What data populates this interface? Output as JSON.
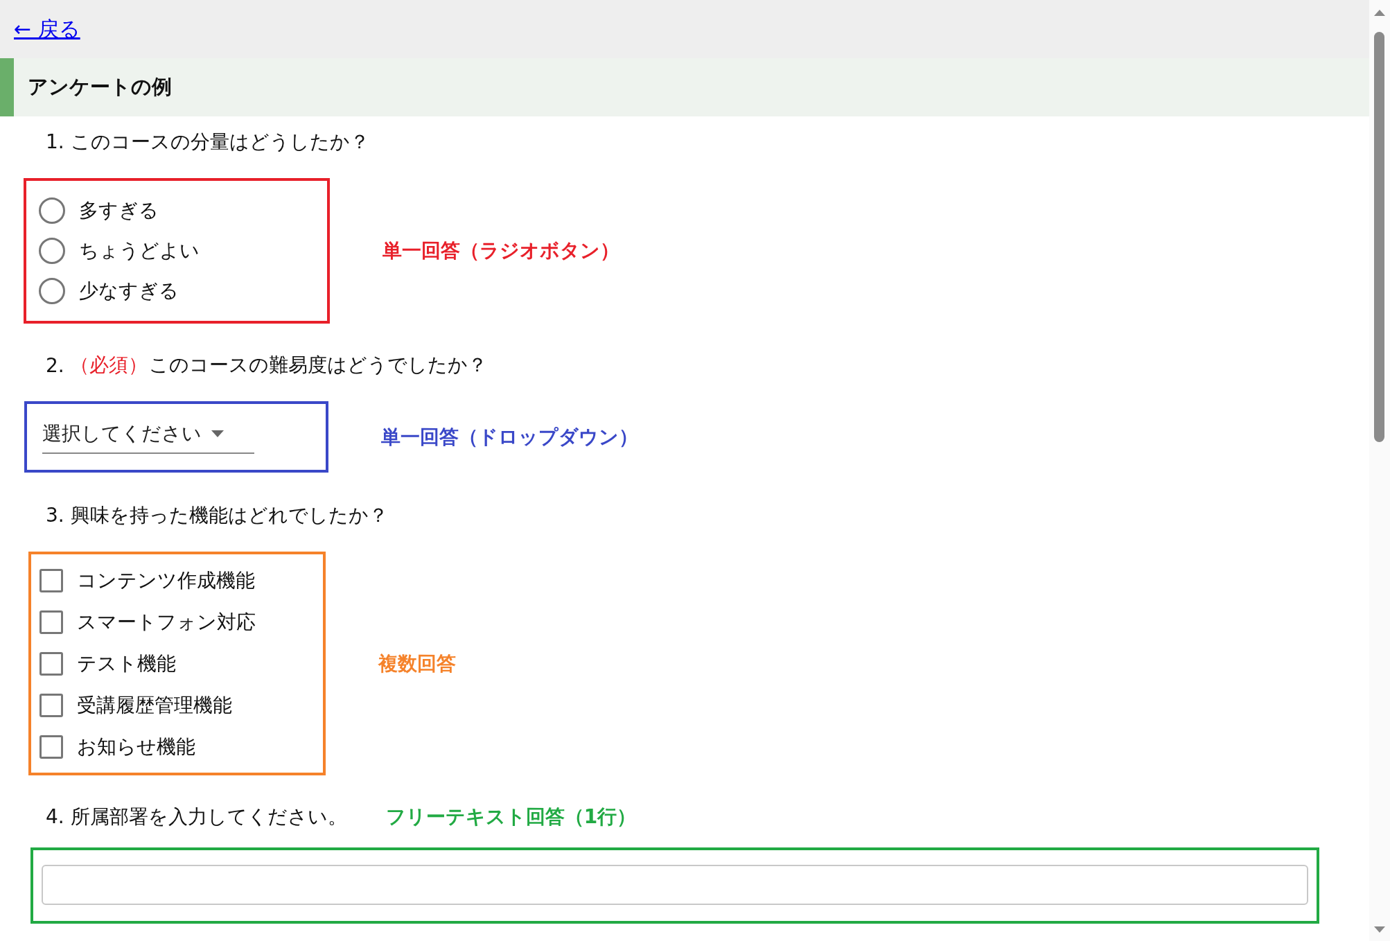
{
  "back_link": "← 戻る",
  "title": "アンケートの例",
  "questions": [
    {
      "kind": "radio",
      "number": "1.",
      "text": "このコースの分量はどうしたか？",
      "color": "#e8202a",
      "annotation": "単一回答（ラジオボタン）",
      "options": [
        {
          "label": "多すぎる",
          "selected": false
        },
        {
          "label": "ちょうどよい",
          "selected": false
        },
        {
          "label": "少なすぎる",
          "selected": false
        }
      ]
    },
    {
      "kind": "dropdown",
      "number": "2.",
      "required": "（必須）",
      "text": "このコースの難易度はどうでしたか？",
      "color": "#3a48c8",
      "annotation": "単一回答（ドロップダウン）",
      "value": "選択してください"
    },
    {
      "kind": "checkbox",
      "number": "3.",
      "text": "興味を持った機能はどれでしたか？",
      "color": "#f5822a",
      "annotation": "複数回答",
      "options": [
        {
          "label": "コンテンツ作成機能",
          "checked": false
        },
        {
          "label": "スマートフォン対応",
          "checked": false
        },
        {
          "label": "テスト機能",
          "checked": false
        },
        {
          "label": "受講履歴管理機能",
          "checked": false
        },
        {
          "label": "お知らせ機能",
          "checked": false
        }
      ]
    },
    {
      "kind": "text",
      "number": "4.",
      "text": "所属部署を入力してください。",
      "color": "#22aa44",
      "annotation": "フリーテキスト回答（1行）"
    }
  ]
}
